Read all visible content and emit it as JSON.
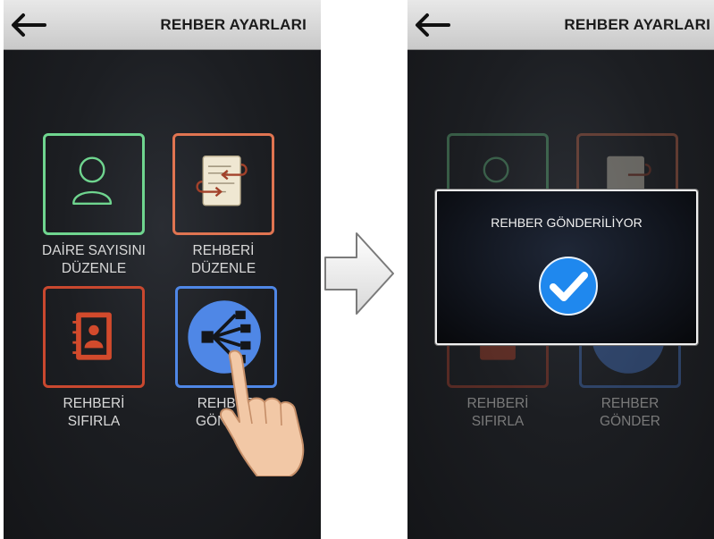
{
  "screens": [
    {
      "header": {
        "title": "REHBER AYARLARI"
      },
      "tiles": [
        {
          "label_1": "DAİRE SAYISINI",
          "label_2": "DÜZENLE"
        },
        {
          "label_1": "REHBERİ",
          "label_2": "DÜZENLE"
        },
        {
          "label_1": "REHBERİ",
          "label_2": "SIFIRLA"
        },
        {
          "label_1": "REHBER",
          "label_2": "GÖNDER"
        }
      ]
    },
    {
      "header": {
        "title": "REHBER AYARLARI"
      },
      "tiles": [
        {
          "label_1": "REHBERİ",
          "label_2": "SIFIRLA"
        },
        {
          "label_1": "REHBER",
          "label_2": "GÖNDER"
        }
      ],
      "dialog": {
        "message": "REHBER GÖNDERİLİYOR"
      }
    }
  ],
  "colors": {
    "green": "#6fd58f",
    "orange": "#e07451",
    "red": "#c9482f",
    "blue": "#4f87e6",
    "check_blue": "#1f88ee"
  },
  "icons": [
    "back-arrow-icon",
    "user-icon",
    "edit-list-icon",
    "contact-book-icon",
    "share-network-icon",
    "check-icon",
    "next-arrow-icon",
    "hand-pointer-icon"
  ]
}
